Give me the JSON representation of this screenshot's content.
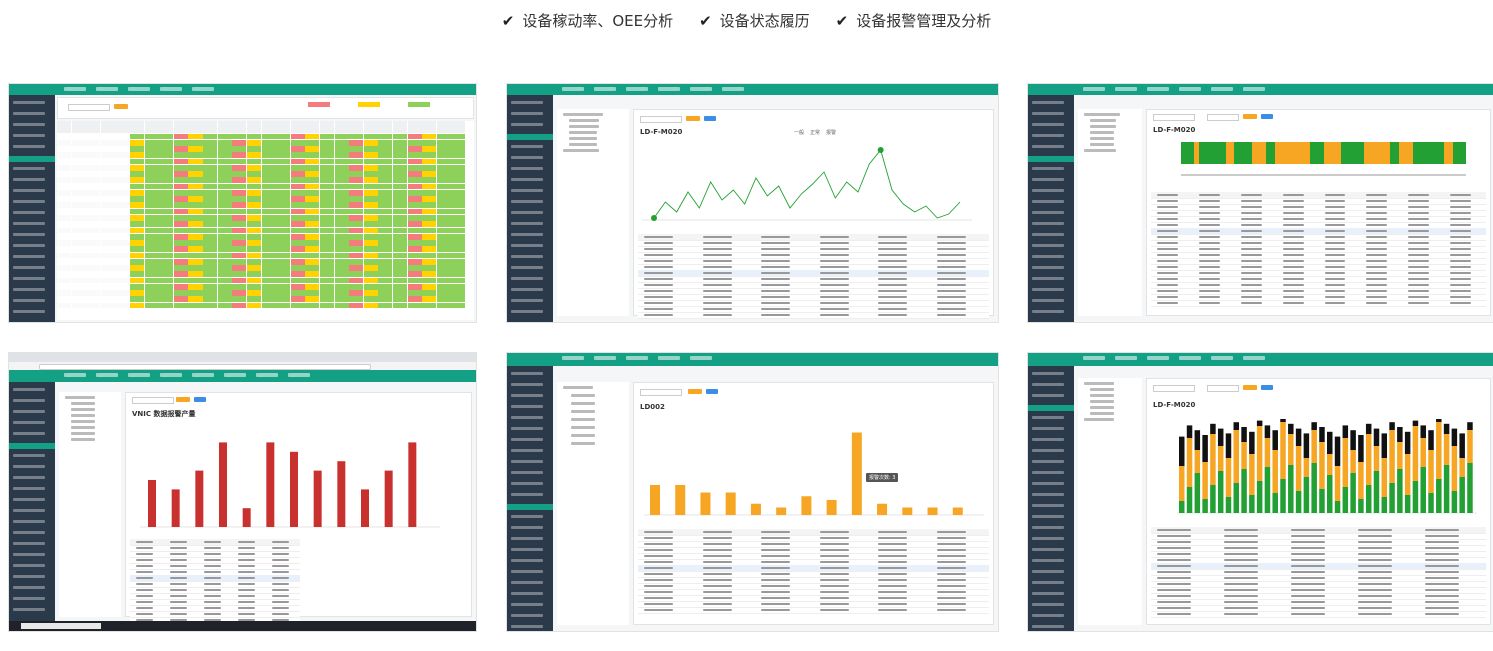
{
  "features": [
    {
      "label": "设备稼动率、OEE分析",
      "icon": "check-icon"
    },
    {
      "label": "设备状态履历",
      "icon": "check-icon"
    },
    {
      "label": "设备报警管理及分析",
      "icon": "check-icon"
    }
  ],
  "screens": {
    "s2": {
      "chart_title": "LD-F-M020",
      "legend": [
        "一般",
        "正常",
        "报警"
      ]
    },
    "s3": {
      "chart_title": "LD-F-M020"
    },
    "s4": {
      "chart_title": "VNIC 数据报警产量"
    },
    "s5": {
      "chart_title": "LD002",
      "callout": "报警次数: 3"
    },
    "s6": {
      "chart_title": "LD-F-M020"
    }
  },
  "colors": {
    "brand": "#14a085",
    "sidebar": "#2b3a4a",
    "orange": "#f6a623",
    "green": "#22a033",
    "red": "#c8312e",
    "yellow": "#ffd200"
  }
}
